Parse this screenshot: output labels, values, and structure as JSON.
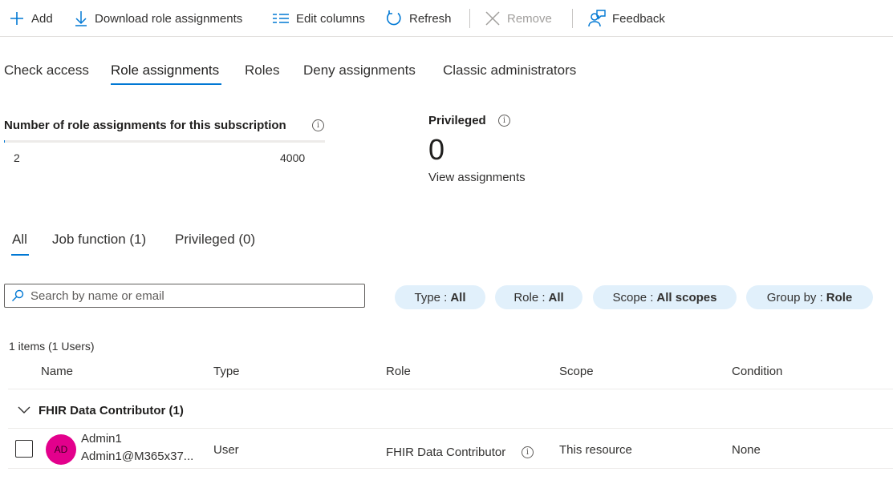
{
  "toolbar": {
    "add_label": "Add",
    "download_label": "Download role assignments",
    "edit_columns_label": "Edit columns",
    "refresh_label": "Refresh",
    "remove_label": "Remove",
    "feedback_label": "Feedback"
  },
  "tabs": [
    {
      "label": "Check access"
    },
    {
      "label": "Role assignments",
      "active": true
    },
    {
      "label": "Roles"
    },
    {
      "label": "Deny assignments"
    },
    {
      "label": "Classic administrators"
    }
  ],
  "summary": {
    "count_title": "Number of role assignments for this subscription",
    "current": "2",
    "limit": "4000",
    "progress_fraction": 0.0005,
    "privileged_title": "Privileged",
    "privileged_count": "0",
    "view_link": "View assignments"
  },
  "filter_tabs": [
    {
      "label": "All",
      "active": true
    },
    {
      "label": "Job function (1)"
    },
    {
      "label": "Privileged (0)"
    }
  ],
  "search": {
    "placeholder": "Search by name or email"
  },
  "filters": [
    {
      "label": "Type :",
      "value": "All"
    },
    {
      "label": "Role :",
      "value": "All"
    },
    {
      "label": "Scope :",
      "value": "All scopes"
    },
    {
      "label": "Group by :",
      "value": "Role"
    }
  ],
  "items_count": "1 items (1 Users)",
  "table": {
    "headers": [
      "Name",
      "Type",
      "Role",
      "Scope",
      "Condition"
    ],
    "group": {
      "label": "FHIR Data Contributor (1)"
    },
    "rows": [
      {
        "initials": "AD",
        "name": "Admin1",
        "email": "Admin1@M365x37...",
        "type": "User",
        "role": "FHIR Data Contributor",
        "scope": "This resource",
        "condition": "None"
      }
    ]
  },
  "colors": {
    "accent": "#0078d4",
    "avatar": "#e3008c",
    "pill": "#e1f0fb"
  }
}
